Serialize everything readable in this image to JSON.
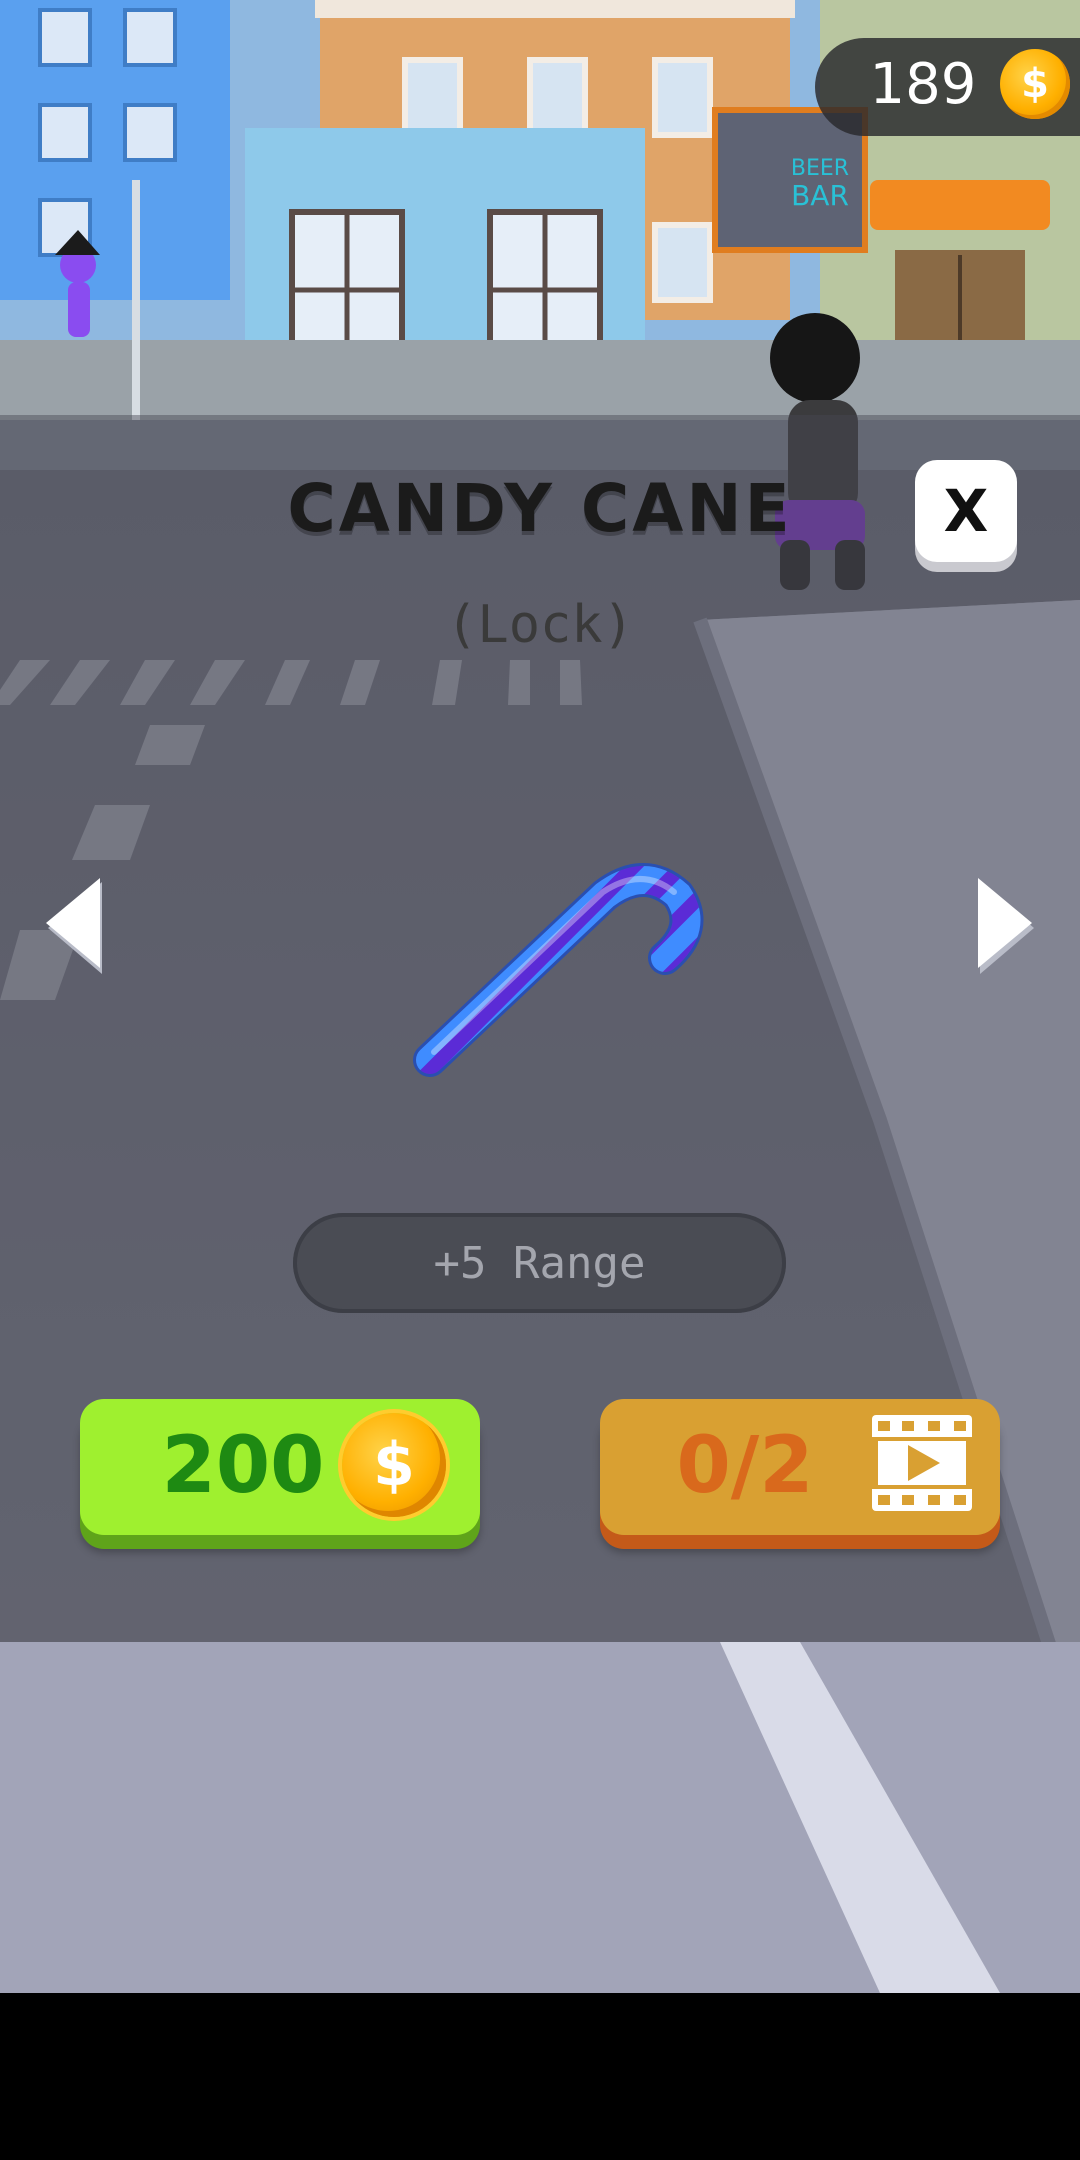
{
  "hud": {
    "coin_balance": "189",
    "coin_symbol": "$"
  },
  "background": {
    "sign_text_line1": "BEER",
    "sign_text_line2": "BAR"
  },
  "item": {
    "name": "CANDY CANE",
    "status": "(Lock)",
    "stat": "+5 Range",
    "colors": {
      "primary": "#3f8cff",
      "stripe": "#5b2bd6"
    }
  },
  "buttons": {
    "close_label": "X",
    "buy_price": "200",
    "buy_coin_symbol": "$",
    "ad_progress": "0/2"
  },
  "icons": {
    "prev": "chevron-left-icon",
    "next": "chevron-right-icon",
    "coin": "coin-icon",
    "video": "video-play-icon"
  },
  "colors": {
    "buy_button": "#9ff02f",
    "ad_button": "#d9a032",
    "overlay": "#46485280"
  }
}
